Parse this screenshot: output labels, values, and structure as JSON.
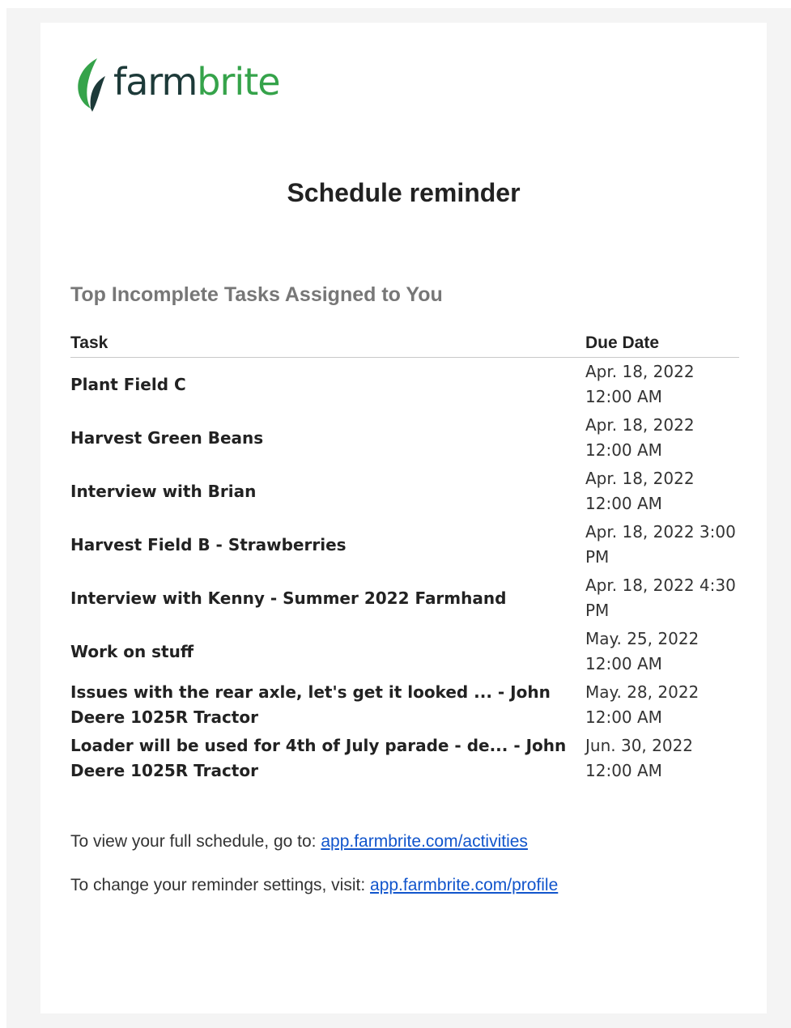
{
  "brand": {
    "name_part1": "farm",
    "name_part2": "brite",
    "colors": {
      "dark": "#1d3a39",
      "green": "#35a34a"
    }
  },
  "heading": "Schedule reminder",
  "section_title": "Top Incomplete Tasks Assigned to You",
  "table": {
    "headers": {
      "task": "Task",
      "due": "Due Date"
    },
    "rows": [
      {
        "task": "Plant Field C",
        "due": "Apr. 18, 2022 12:00 AM"
      },
      {
        "task": "Harvest Green Beans",
        "due": "Apr. 18, 2022 12:00 AM"
      },
      {
        "task": "Interview with Brian",
        "due": "Apr. 18, 2022 12:00 AM"
      },
      {
        "task": "Harvest Field B - Strawberries",
        "due": "Apr. 18, 2022 3:00 PM"
      },
      {
        "task": "Interview with Kenny - Summer 2022 Farmhand",
        "due": "Apr. 18, 2022 4:30 PM"
      },
      {
        "task": "Work on stuff",
        "due": "May. 25, 2022 12:00 AM"
      },
      {
        "task": "Issues with the rear axle, let's get it looked ... - John Deere 1025R Tractor",
        "due": "May. 28, 2022 12:00 AM"
      },
      {
        "task": "Loader will be used for 4th of July parade - de... - John Deere 1025R Tractor",
        "due": "Jun. 30, 2022 12:00 AM"
      }
    ]
  },
  "footer": {
    "schedule_text": "To view your full schedule, go to: ",
    "schedule_link": "app.farmbrite.com/activities",
    "settings_text": "To change your reminder settings, visit: ",
    "settings_link": "app.farmbrite.com/profile"
  },
  "link_color": "#1155cc"
}
